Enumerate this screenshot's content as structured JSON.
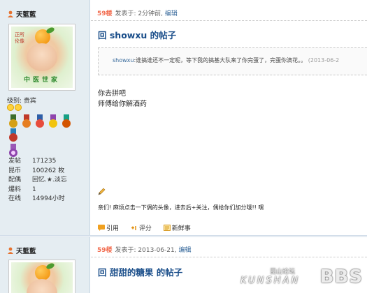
{
  "post1": {
    "author": "天藍藍",
    "avatar_caption": "中医世家",
    "avatar_stamp": "正所伦像",
    "level_label": "级别: 贵宾",
    "stats": [
      {
        "key": "发帖",
        "value": "171235"
      },
      {
        "key": "昆币",
        "value": "100262 枚"
      },
      {
        "key": "配偶",
        "value": "回忆.★.淡忘"
      },
      {
        "key": "爆料",
        "value": "1"
      },
      {
        "key": "在线",
        "value": "14994小时"
      }
    ],
    "floor": "59楼",
    "posted_at": "发表于: 2分钟前",
    "edit": "编辑",
    "title": "回 showxu 的帖子",
    "quote": {
      "user": "showxu",
      "text": ":谁搞谁还不一定呢，等下我的搞基大队来了你完蛋了，完蛋你滴花。。",
      "time": "(2013-06-2"
    },
    "body": [
      "你去拼吧",
      "师傅给你解酒药"
    ],
    "signature": "亲们! 麻烦点击一下偶的头像，进去后+关注，偶给你们加分哦!! 嘿",
    "actions": {
      "quote": "引用",
      "rate": "评分",
      "news": "新鲜事"
    }
  },
  "post2": {
    "author": "天藍藍",
    "floor": "59楼",
    "posted_at": "发表于: 2013-06-21",
    "edit": "编辑",
    "title": "回 甜甜的糖果 的帖子"
  },
  "watermark": {
    "top": "昆山论坛",
    "name": "KUNSHAN",
    "bbs": "BBS"
  },
  "colors": {
    "sidebar_bg": "#e5edf2",
    "title": "#1a4e8a",
    "floor": "#f26c4f",
    "link": "#336699"
  }
}
